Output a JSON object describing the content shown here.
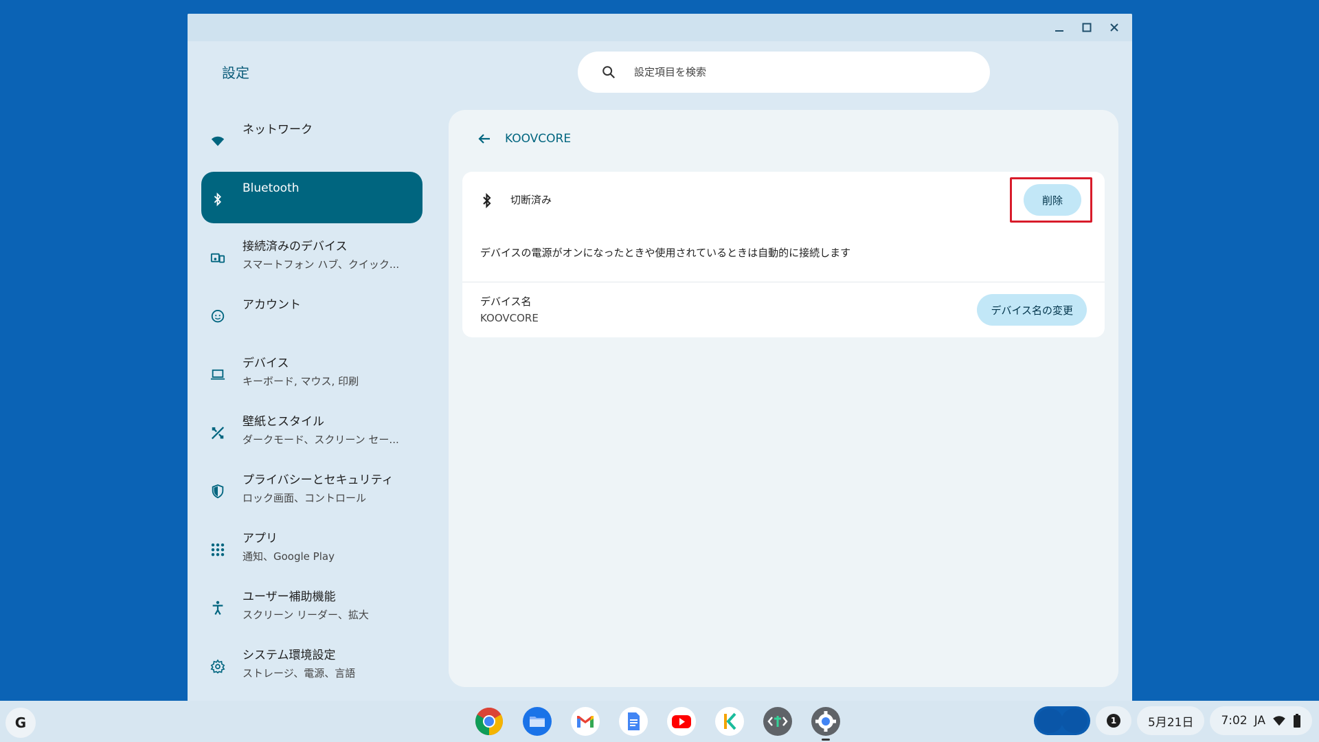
{
  "window": {
    "app_title": "設定",
    "controls": {
      "minimize": "—",
      "maximize": "☐",
      "close": "✕"
    }
  },
  "search": {
    "placeholder": "設定項目を検索"
  },
  "sidebar": {
    "items": [
      {
        "title": "ネットワーク",
        "sub": "",
        "icon": "wifi-icon"
      },
      {
        "title": "Bluetooth",
        "sub": "",
        "icon": "bluetooth-icon",
        "active": true
      },
      {
        "title": "接続済みのデバイス",
        "sub": "スマートフォン ハブ、クイック...",
        "icon": "devices-icon"
      },
      {
        "title": "アカウント",
        "sub": "",
        "icon": "account-icon"
      },
      {
        "title": "デバイス",
        "sub": "キーボード, マウス, 印刷",
        "icon": "laptop-icon"
      },
      {
        "title": "壁紙とスタイル",
        "sub": "ダークモード、スクリーン セー...",
        "icon": "palette-icon"
      },
      {
        "title": "プライバシーとセキュリティ",
        "sub": "ロック画面、コントロール",
        "icon": "shield-icon"
      },
      {
        "title": "アプリ",
        "sub": "通知、Google Play",
        "icon": "apps-grid-icon"
      },
      {
        "title": "ユーザー補助機能",
        "sub": "スクリーン リーダー、拡大",
        "icon": "accessibility-icon"
      },
      {
        "title": "システム環境設定",
        "sub": "ストレージ、電源、言語",
        "icon": "gear-icon"
      }
    ]
  },
  "detail": {
    "title": "KOOVCORE",
    "status": "切断済み",
    "delete_label": "削除",
    "auto_connect_text": "デバイスの電源がオンになったときや使用されているときは自動的に接続します",
    "device_name_label": "デバイス名",
    "device_name_value": "KOOVCORE",
    "rename_label": "デバイス名の変更"
  },
  "shelf": {
    "launcher_label": "G",
    "apps": [
      "chrome-icon",
      "files-icon",
      "gmail-icon",
      "docs-icon",
      "youtube-icon",
      "kami-icon",
      "text-editor-icon",
      "settings-icon"
    ],
    "notification_count": "1",
    "date": "5月21日",
    "time": "7:02",
    "ime": "JA"
  },
  "colors": {
    "accent": "#00657f",
    "desktop": "#0b63b5",
    "highlight": "#d81b2a",
    "button_bg": "#c2e7f7"
  }
}
